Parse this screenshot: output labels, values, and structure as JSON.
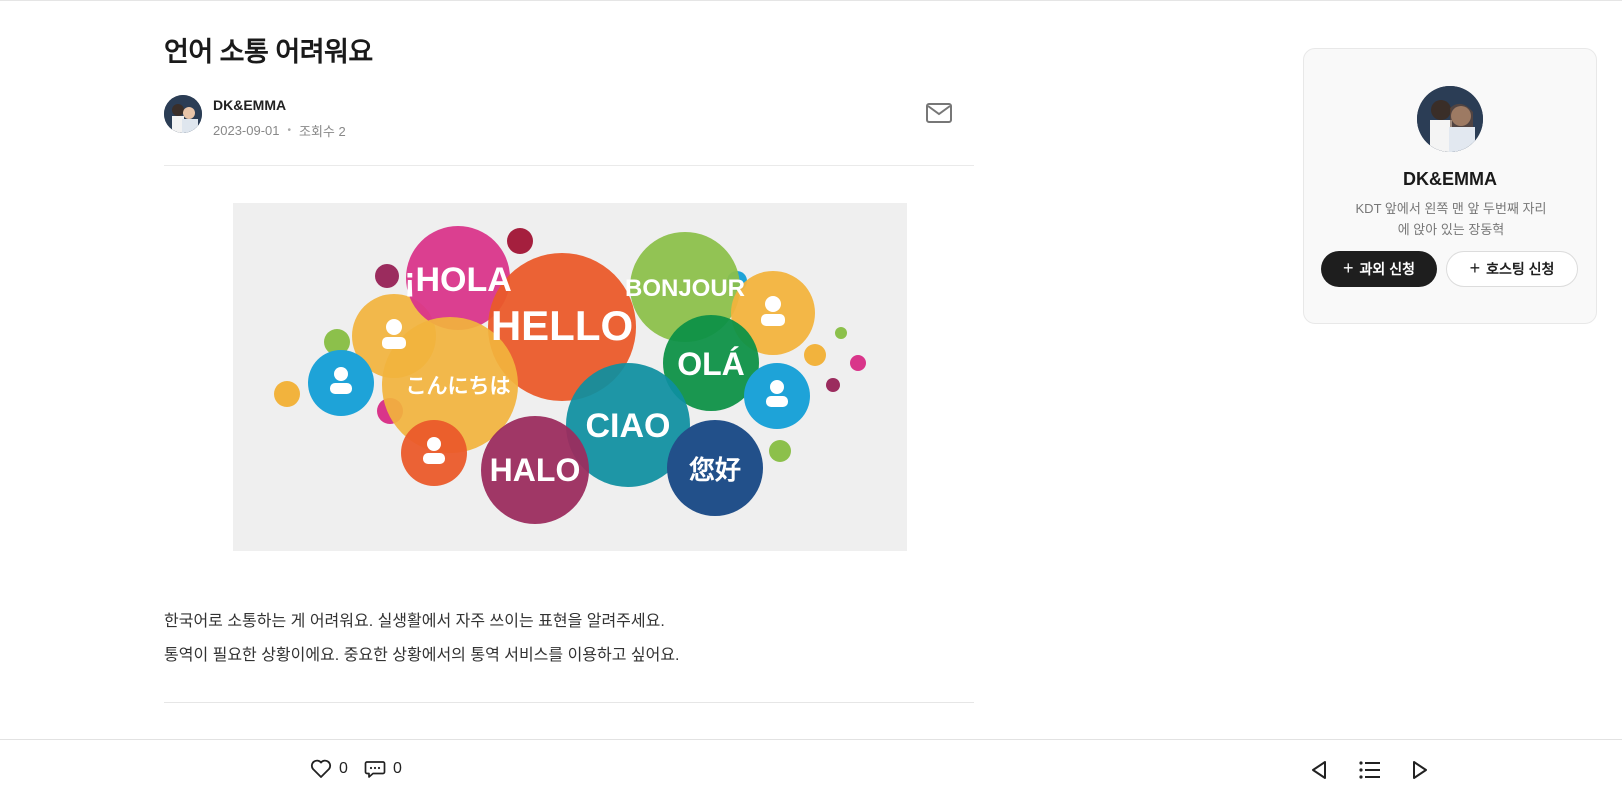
{
  "post": {
    "title": "언어 소통 어려워요",
    "author": "DK&EMMA",
    "date": "2023-09-01",
    "views": "조회수 2",
    "body_lines": [
      "한국어로 소통하는 게 어려워요. 실생활에서 자주 쓰이는 표현을 알려주세요.",
      "통역이 필요한 상황이에요. 중요한 상황에서의 통역 서비스를 이용하고 싶어요."
    ]
  },
  "hero": {
    "bubbles": [
      "¡HOLA",
      "HELLO",
      "BONJOUR",
      "OLÁ",
      "こんにちは",
      "CIAO",
      "HALO",
      "您好"
    ]
  },
  "profile": {
    "name": "DK&EMMA",
    "bio_lines": [
      "KDT 앞에서 왼쪽 맨 앞 두번째 자리",
      "에 앉아 있는 장동혁"
    ],
    "tutoring_button": "과외 신청",
    "hosting_button": "호스팅 신청"
  },
  "footer": {
    "likes": "0",
    "comments": "0"
  },
  "icons": {
    "mail": "mail-icon",
    "like": "heart-icon",
    "comment": "comment-icon",
    "prev": "prev-icon",
    "list": "list-icon",
    "next": "next-icon"
  }
}
